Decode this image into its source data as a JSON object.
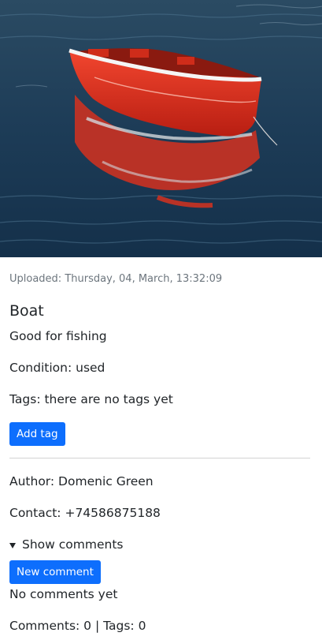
{
  "post": {
    "uploaded": "Uploaded: Thursday, 04, March, 13:32:09",
    "title": "Boat",
    "description": "Good for fishing",
    "condition": "Condition: used",
    "tags_text": "Tags: there are no tags yet",
    "add_tag_label": "Add tag",
    "author": "Author: Domenic Green",
    "contact": "Contact: +74586875188",
    "show_comments_label": "Show comments",
    "new_comment_label": "New comment",
    "no_comments": "No comments yet",
    "counts": "Comments: 0 | Tags: 0"
  },
  "colors": {
    "primary_button": "#0d6efd",
    "muted_text": "#6c757d",
    "water": "#1f3f5c",
    "boat": "#e8311f"
  }
}
